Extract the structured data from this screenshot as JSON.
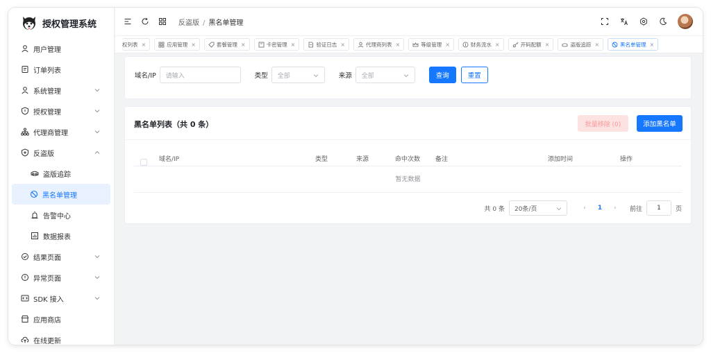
{
  "app": {
    "title": "授权管理系统"
  },
  "sidebar": {
    "items": [
      {
        "label": "用户管理",
        "icon": "user-icon",
        "expandable": false
      },
      {
        "label": "订单列表",
        "icon": "order-list-icon",
        "expandable": false
      },
      {
        "label": "系统管理",
        "icon": "user-icon",
        "expandable": true
      },
      {
        "label": "授权管理",
        "icon": "shield-icon",
        "expandable": true
      },
      {
        "label": "代理商管理",
        "icon": "org-tree-icon",
        "expandable": true
      },
      {
        "label": "反盗版",
        "icon": "shield-plus-icon",
        "expandable": true,
        "expanded": true
      },
      {
        "label": "盗版追踪",
        "icon": "goggles-icon",
        "sub": true
      },
      {
        "label": "黑名单管理",
        "icon": "ban-icon",
        "sub": true,
        "active": true
      },
      {
        "label": "告警中心",
        "icon": "alarm-icon",
        "sub": true
      },
      {
        "label": "数据报表",
        "icon": "bar-chart-icon",
        "sub": true
      },
      {
        "label": "结果页面",
        "icon": "check-circle-icon",
        "expandable": true
      },
      {
        "label": "异常页面",
        "icon": "warning-circle-icon",
        "expandable": true
      },
      {
        "label": "SDK 接入",
        "icon": "code-icon",
        "expandable": true
      },
      {
        "label": "应用商店",
        "icon": "store-icon",
        "expandable": false
      },
      {
        "label": "在线更新",
        "icon": "cloud-upload-icon",
        "expandable": false
      }
    ]
  },
  "header": {
    "breadcrumb": [
      "反盗版",
      "黑名单管理"
    ]
  },
  "tabs": [
    {
      "label": "权列表",
      "icon": "",
      "first": true
    },
    {
      "label": "应用管理",
      "icon": "grid-icon"
    },
    {
      "label": "套餐管理",
      "icon": "tag-icon"
    },
    {
      "label": "卡密管理",
      "icon": "card-icon"
    },
    {
      "label": "验证日志",
      "icon": "doc-icon"
    },
    {
      "label": "代理商列表",
      "icon": "user-icon"
    },
    {
      "label": "等级管理",
      "icon": "crown-icon"
    },
    {
      "label": "财务流水",
      "icon": "coin-icon"
    },
    {
      "label": "开码配额",
      "icon": "key-icon"
    },
    {
      "label": "盗版追踪",
      "icon": "goggles-icon"
    },
    {
      "label": "黑名单管理",
      "icon": "ban-icon",
      "active": true
    }
  ],
  "filter": {
    "domain_label": "域名/IP",
    "domain_placeholder": "请输入",
    "type_label": "类型",
    "type_value": "全部",
    "source_label": "来源",
    "source_value": "全部",
    "query_btn": "查询",
    "reset_btn": "重置"
  },
  "list": {
    "title": "黑名单列表（共 0 条）",
    "batch_remove_btn": "批量移除 (0)",
    "add_btn": "添加黑名单",
    "columns": [
      "域名/IP",
      "类型",
      "来源",
      "命中次数",
      "备注",
      "添加时间",
      "操作"
    ],
    "empty_text": "暂无数据"
  },
  "pagination": {
    "total_text": "共 0 条",
    "page_size": "20条/页",
    "prev": "‹",
    "current_page": "1",
    "next": "›",
    "goto_label": "前往",
    "goto_value": "1",
    "page_unit": "页"
  },
  "colors": {
    "primary": "#1677ff",
    "active_bg": "#e8f1ff",
    "danger_light": "#fde2e2"
  }
}
